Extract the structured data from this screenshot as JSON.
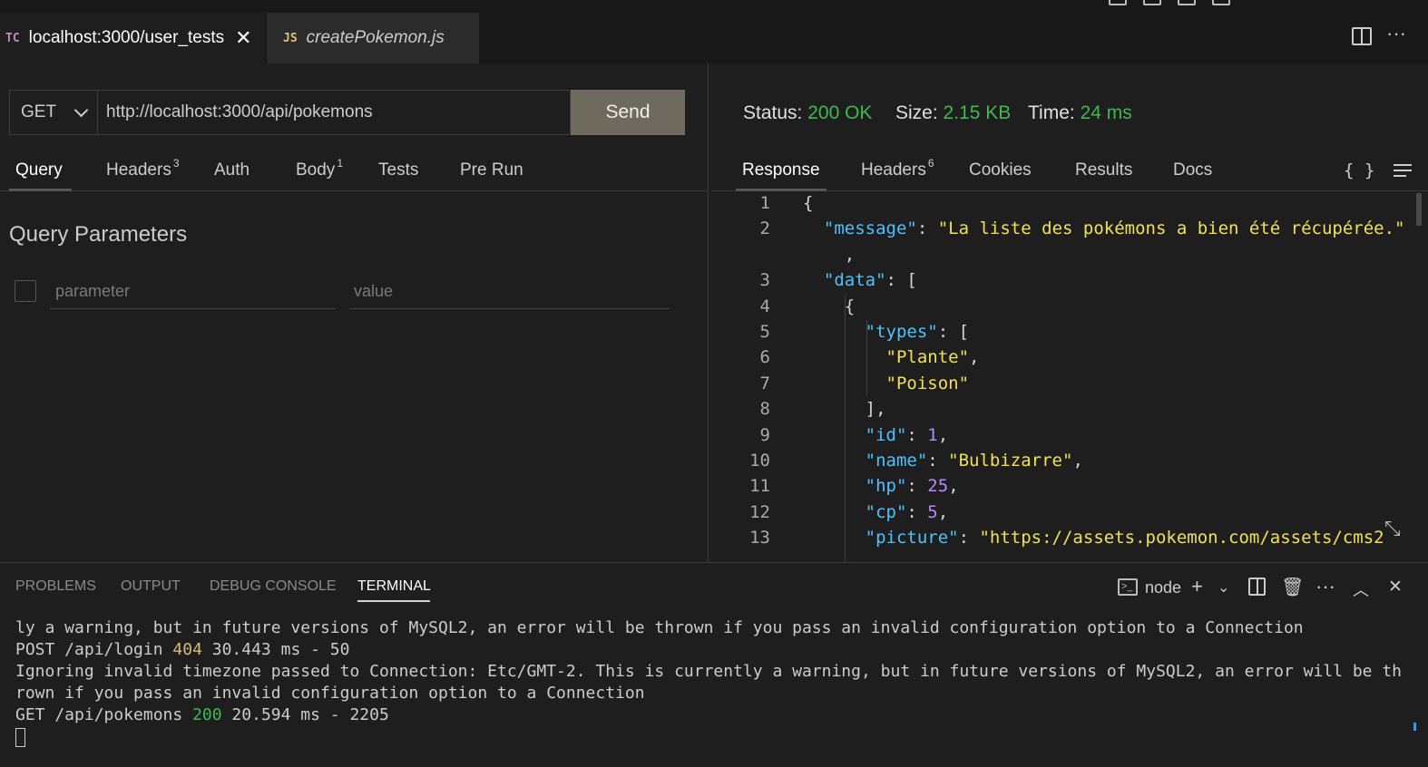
{
  "tabs": [
    {
      "badge": "TC",
      "title": "localhost:3000/user_tests"
    },
    {
      "badge": "JS",
      "title": "createPokemon.js"
    }
  ],
  "editor_actions": {
    "split_icon": "split-editor-icon",
    "more_icon": "more-actions-icon"
  },
  "request": {
    "method": "GET",
    "url": "http://localhost:3000/api/pokemons",
    "send_label": "Send",
    "tabs": [
      {
        "label": "Query",
        "count": ""
      },
      {
        "label": "Headers",
        "count": "3"
      },
      {
        "label": "Auth",
        "count": ""
      },
      {
        "label": "Body",
        "count": "1"
      },
      {
        "label": "Tests",
        "count": ""
      },
      {
        "label": "Pre Run",
        "count": ""
      }
    ],
    "active_tab": "Query",
    "query_title": "Query Parameters",
    "param_placeholder": "parameter",
    "value_placeholder": "value"
  },
  "response": {
    "status_label": "Status:",
    "status_value": "200 OK",
    "size_label": "Size:",
    "size_value": "2.15 KB",
    "time_label": "Time:",
    "time_value": "24 ms",
    "tabs": [
      {
        "label": "Response",
        "count": ""
      },
      {
        "label": "Headers",
        "count": "6"
      },
      {
        "label": "Cookies",
        "count": ""
      },
      {
        "label": "Results",
        "count": ""
      },
      {
        "label": "Docs",
        "count": ""
      }
    ],
    "active_tab": "Response",
    "braces_label": "{ }",
    "code_lines": [
      {
        "n": "1",
        "tokens": [
          [
            "p",
            "{"
          ]
        ]
      },
      {
        "n": "2",
        "tokens": [
          [
            "p",
            "  "
          ],
          [
            "k",
            "\"message\""
          ],
          [
            "p",
            ": "
          ],
          [
            "s",
            "\"La liste des pokémons a bien été récupérée.\""
          ]
        ]
      },
      {
        "n": "",
        "tokens": [
          [
            "p",
            "    ,"
          ]
        ]
      },
      {
        "n": "3",
        "tokens": [
          [
            "p",
            "  "
          ],
          [
            "k",
            "\"data\""
          ],
          [
            "p",
            ": ["
          ]
        ]
      },
      {
        "n": "4",
        "tokens": [
          [
            "p",
            "    {"
          ]
        ]
      },
      {
        "n": "5",
        "tokens": [
          [
            "p",
            "      "
          ],
          [
            "k",
            "\"types\""
          ],
          [
            "p",
            ": ["
          ]
        ]
      },
      {
        "n": "6",
        "tokens": [
          [
            "p",
            "        "
          ],
          [
            "s",
            "\"Plante\""
          ],
          [
            "p",
            ","
          ]
        ]
      },
      {
        "n": "7",
        "tokens": [
          [
            "p",
            "        "
          ],
          [
            "s",
            "\"Poison\""
          ]
        ]
      },
      {
        "n": "8",
        "tokens": [
          [
            "p",
            "      ],"
          ]
        ]
      },
      {
        "n": "9",
        "tokens": [
          [
            "p",
            "      "
          ],
          [
            "k",
            "\"id\""
          ],
          [
            "p",
            ": "
          ],
          [
            "n",
            "1"
          ],
          [
            "p",
            ","
          ]
        ]
      },
      {
        "n": "10",
        "tokens": [
          [
            "p",
            "      "
          ],
          [
            "k",
            "\"name\""
          ],
          [
            "p",
            ": "
          ],
          [
            "s",
            "\"Bulbizarre\""
          ],
          [
            "p",
            ","
          ]
        ]
      },
      {
        "n": "11",
        "tokens": [
          [
            "p",
            "      "
          ],
          [
            "k",
            "\"hp\""
          ],
          [
            "p",
            ": "
          ],
          [
            "n",
            "25"
          ],
          [
            "p",
            ","
          ]
        ]
      },
      {
        "n": "12",
        "tokens": [
          [
            "p",
            "      "
          ],
          [
            "k",
            "\"cp\""
          ],
          [
            "p",
            ": "
          ],
          [
            "n",
            "5"
          ],
          [
            "p",
            ","
          ]
        ]
      },
      {
        "n": "13",
        "tokens": [
          [
            "p",
            "      "
          ],
          [
            "k",
            "\"picture\""
          ],
          [
            "p",
            ": "
          ],
          [
            "s",
            "\"https://assets.pokemon.com/assets/cms2"
          ]
        ]
      }
    ]
  },
  "panel": {
    "tabs": [
      "PROBLEMS",
      "OUTPUT",
      "DEBUG CONSOLE",
      "TERMINAL"
    ],
    "active_tab": "TERMINAL",
    "shell_label": "node",
    "icons": [
      "terminal-shell-icon",
      "add-icon",
      "chevron-down-icon",
      "split-terminal-icon",
      "trash-icon",
      "more-icon",
      "chevron-up-icon",
      "close-icon"
    ]
  },
  "terminal_lines": [
    [
      [
        "p",
        "ly a warning, but in future versions of MySQL2, an error will be thrown if you pass an invalid configuration option to a Connection"
      ]
    ],
    [
      [
        "p",
        "POST /api/login "
      ],
      [
        "y",
        "404"
      ],
      [
        "p",
        " 30.443 ms - 50"
      ]
    ],
    [
      [
        "p",
        "Ignoring invalid timezone passed to Connection: Etc/GMT-2. This is currently a warning, but in future versions of MySQL2, an error will be thrown if you pass an invalid configuration option to a Connection"
      ]
    ],
    [
      [
        "p",
        "GET /api/pokemons "
      ],
      [
        "g",
        "200"
      ],
      [
        "p",
        " 20.594 ms - 2205"
      ]
    ]
  ],
  "colors": {
    "status_green": "#3fb950",
    "json_key": "#4fc1ff",
    "json_string": "#f1e05a",
    "json_number": "#b689ff",
    "send_button": "#6e6a5e"
  }
}
